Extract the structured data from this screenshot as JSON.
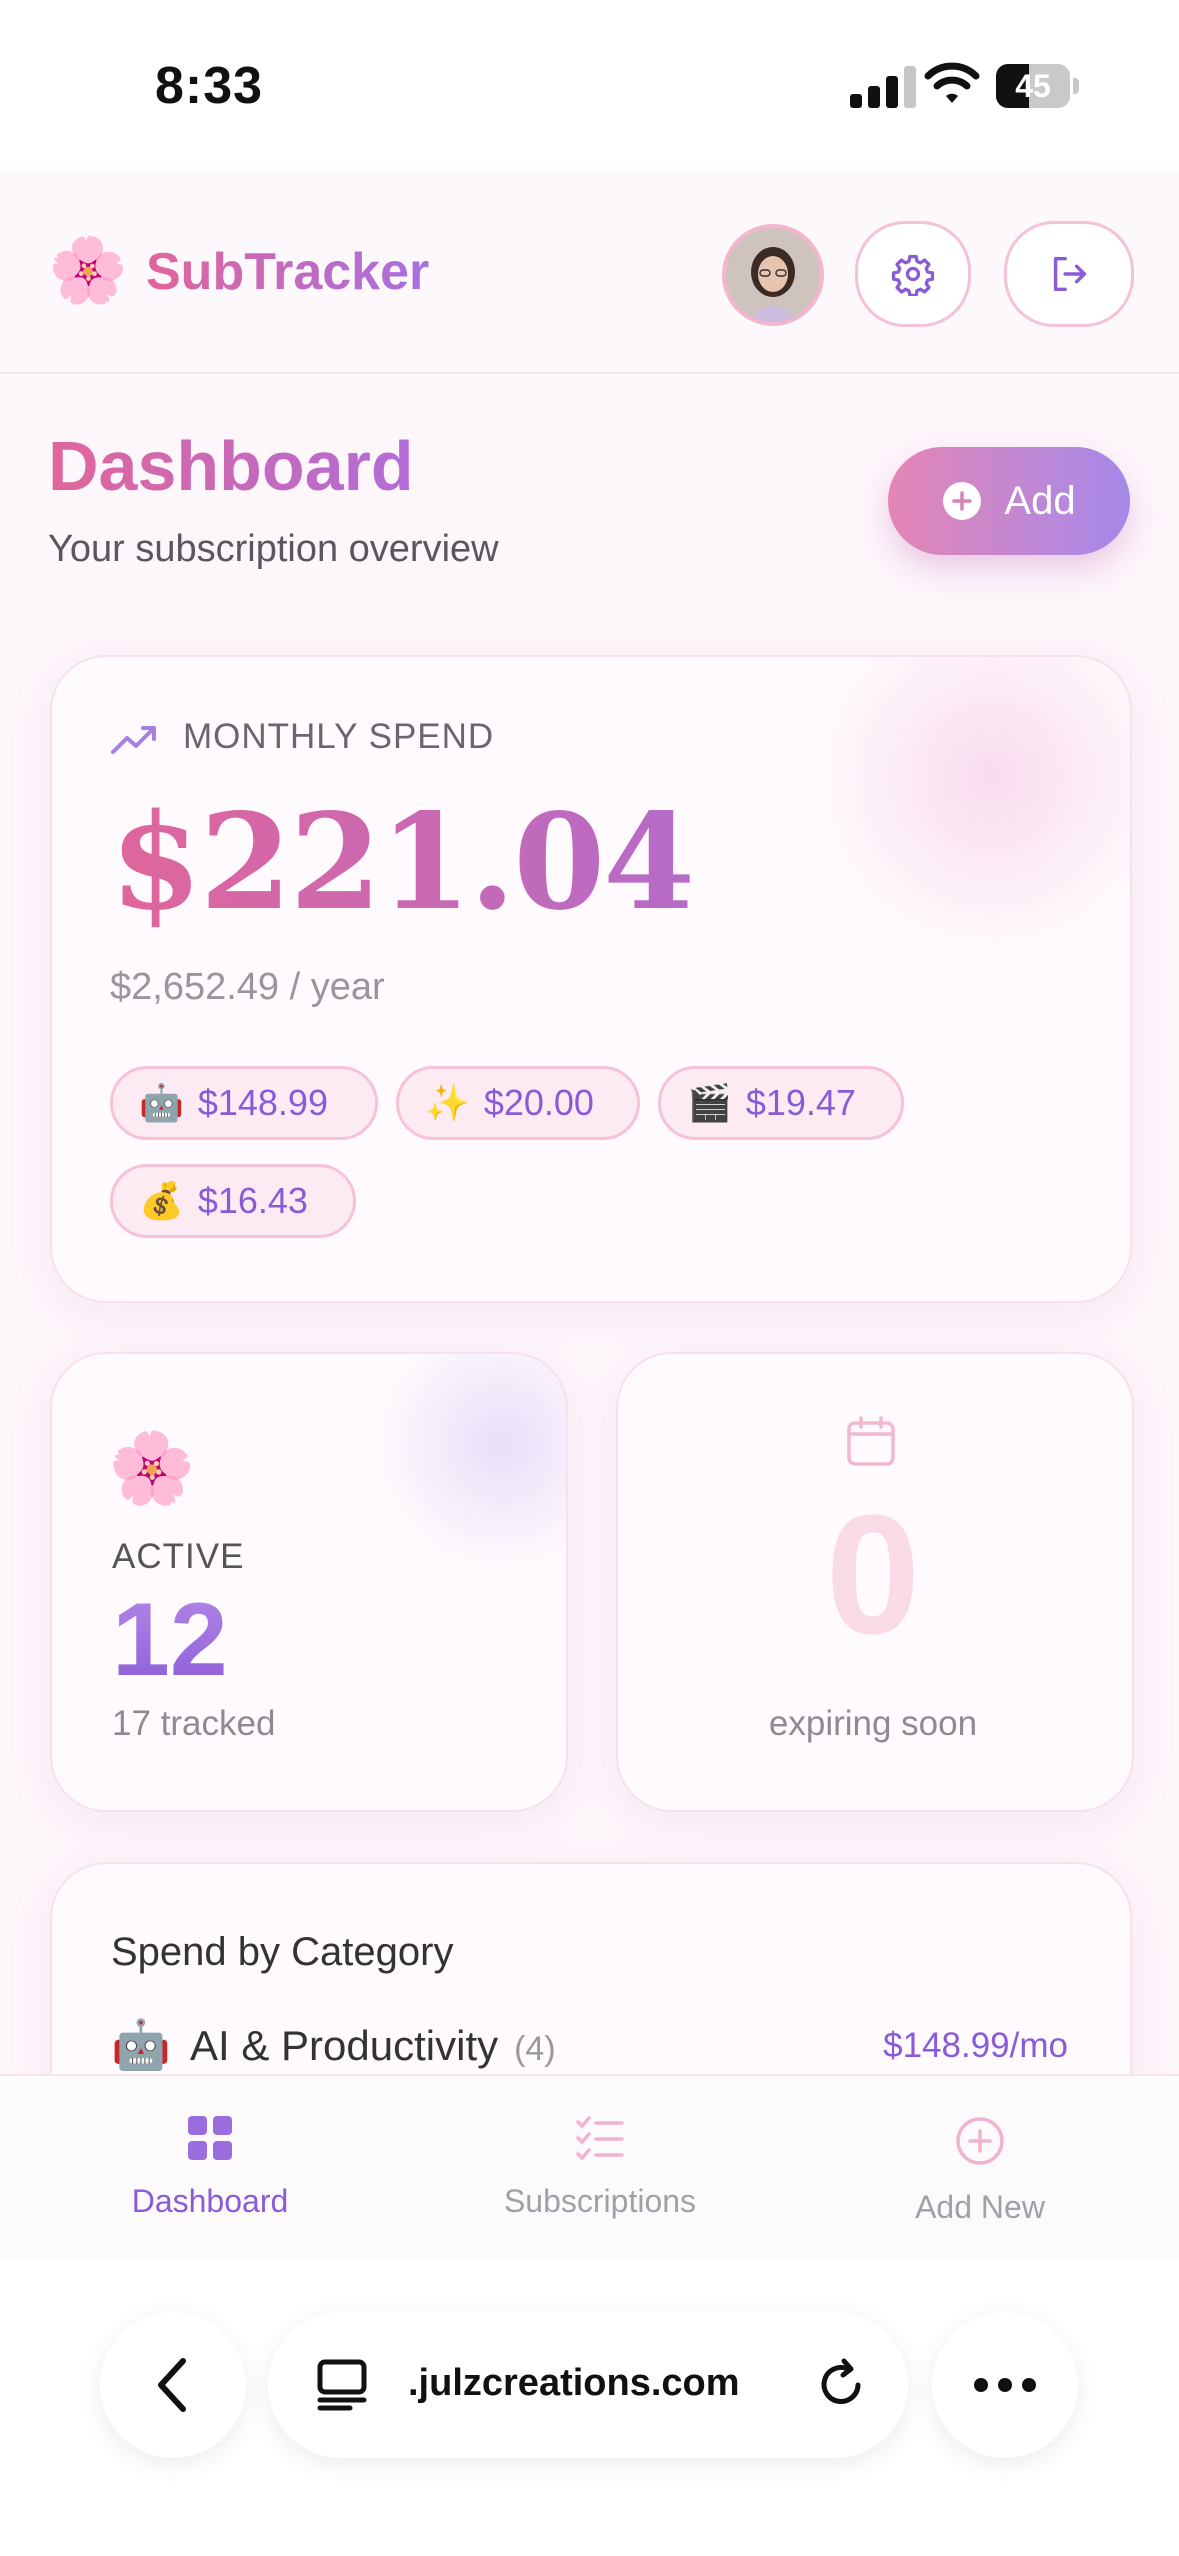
{
  "status_bar": {
    "time": "8:33",
    "battery": "45",
    "battery_level": 0.45
  },
  "header": {
    "logo_emoji": "🌸",
    "brand": "SubTracker"
  },
  "page": {
    "title": "Dashboard",
    "subtitle": "Your subscription overview",
    "add_label": "Add"
  },
  "monthly": {
    "label": "MONTHLY SPEND",
    "amount": "$221.04",
    "yearly": "$2,652.49 / year",
    "chips": [
      {
        "emoji": "🤖",
        "value": "$148.99"
      },
      {
        "emoji": "✨",
        "value": "$20.00"
      },
      {
        "emoji": "🎬",
        "value": "$19.47"
      },
      {
        "emoji": "💰",
        "value": "$16.43"
      }
    ]
  },
  "active": {
    "emoji": "🌸",
    "label": "ACTIVE",
    "count": "12",
    "tracked": "17 tracked"
  },
  "expiring": {
    "count": "0",
    "label": "expiring soon"
  },
  "category": {
    "title": "Spend by Category",
    "rows": [
      {
        "emoji": "🤖",
        "name": "AI & Productivity",
        "count": "(4)",
        "amount": "$148.99/mo"
      }
    ]
  },
  "tabs": [
    {
      "label": "Dashboard",
      "icon": "grid-icon",
      "active": true
    },
    {
      "label": "Subscriptions",
      "icon": "checklist-icon",
      "active": false
    },
    {
      "label": "Add New",
      "icon": "plus-circle-icon",
      "active": false
    }
  ],
  "browser": {
    "url": ".julzcreations.com"
  },
  "colors": {
    "accent_purple": "#8a5bd6",
    "accent_pink": "#e0669a"
  }
}
